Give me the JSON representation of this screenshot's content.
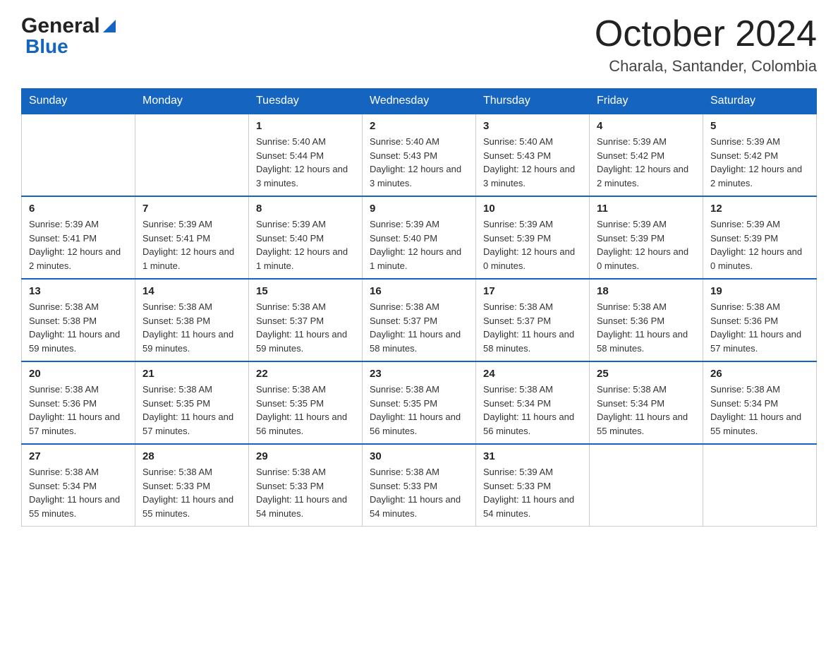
{
  "header": {
    "logo_general": "General",
    "logo_blue": "Blue",
    "month_title": "October 2024",
    "location": "Charala, Santander, Colombia"
  },
  "days_of_week": [
    "Sunday",
    "Monday",
    "Tuesday",
    "Wednesday",
    "Thursday",
    "Friday",
    "Saturday"
  ],
  "weeks": [
    [
      {
        "day": "",
        "sunrise": "",
        "sunset": "",
        "daylight": ""
      },
      {
        "day": "",
        "sunrise": "",
        "sunset": "",
        "daylight": ""
      },
      {
        "day": "1",
        "sunrise": "Sunrise: 5:40 AM",
        "sunset": "Sunset: 5:44 PM",
        "daylight": "Daylight: 12 hours and 3 minutes."
      },
      {
        "day": "2",
        "sunrise": "Sunrise: 5:40 AM",
        "sunset": "Sunset: 5:43 PM",
        "daylight": "Daylight: 12 hours and 3 minutes."
      },
      {
        "day": "3",
        "sunrise": "Sunrise: 5:40 AM",
        "sunset": "Sunset: 5:43 PM",
        "daylight": "Daylight: 12 hours and 3 minutes."
      },
      {
        "day": "4",
        "sunrise": "Sunrise: 5:39 AM",
        "sunset": "Sunset: 5:42 PM",
        "daylight": "Daylight: 12 hours and 2 minutes."
      },
      {
        "day": "5",
        "sunrise": "Sunrise: 5:39 AM",
        "sunset": "Sunset: 5:42 PM",
        "daylight": "Daylight: 12 hours and 2 minutes."
      }
    ],
    [
      {
        "day": "6",
        "sunrise": "Sunrise: 5:39 AM",
        "sunset": "Sunset: 5:41 PM",
        "daylight": "Daylight: 12 hours and 2 minutes."
      },
      {
        "day": "7",
        "sunrise": "Sunrise: 5:39 AM",
        "sunset": "Sunset: 5:41 PM",
        "daylight": "Daylight: 12 hours and 1 minute."
      },
      {
        "day": "8",
        "sunrise": "Sunrise: 5:39 AM",
        "sunset": "Sunset: 5:40 PM",
        "daylight": "Daylight: 12 hours and 1 minute."
      },
      {
        "day": "9",
        "sunrise": "Sunrise: 5:39 AM",
        "sunset": "Sunset: 5:40 PM",
        "daylight": "Daylight: 12 hours and 1 minute."
      },
      {
        "day": "10",
        "sunrise": "Sunrise: 5:39 AM",
        "sunset": "Sunset: 5:39 PM",
        "daylight": "Daylight: 12 hours and 0 minutes."
      },
      {
        "day": "11",
        "sunrise": "Sunrise: 5:39 AM",
        "sunset": "Sunset: 5:39 PM",
        "daylight": "Daylight: 12 hours and 0 minutes."
      },
      {
        "day": "12",
        "sunrise": "Sunrise: 5:39 AM",
        "sunset": "Sunset: 5:39 PM",
        "daylight": "Daylight: 12 hours and 0 minutes."
      }
    ],
    [
      {
        "day": "13",
        "sunrise": "Sunrise: 5:38 AM",
        "sunset": "Sunset: 5:38 PM",
        "daylight": "Daylight: 11 hours and 59 minutes."
      },
      {
        "day": "14",
        "sunrise": "Sunrise: 5:38 AM",
        "sunset": "Sunset: 5:38 PM",
        "daylight": "Daylight: 11 hours and 59 minutes."
      },
      {
        "day": "15",
        "sunrise": "Sunrise: 5:38 AM",
        "sunset": "Sunset: 5:37 PM",
        "daylight": "Daylight: 11 hours and 59 minutes."
      },
      {
        "day": "16",
        "sunrise": "Sunrise: 5:38 AM",
        "sunset": "Sunset: 5:37 PM",
        "daylight": "Daylight: 11 hours and 58 minutes."
      },
      {
        "day": "17",
        "sunrise": "Sunrise: 5:38 AM",
        "sunset": "Sunset: 5:37 PM",
        "daylight": "Daylight: 11 hours and 58 minutes."
      },
      {
        "day": "18",
        "sunrise": "Sunrise: 5:38 AM",
        "sunset": "Sunset: 5:36 PM",
        "daylight": "Daylight: 11 hours and 58 minutes."
      },
      {
        "day": "19",
        "sunrise": "Sunrise: 5:38 AM",
        "sunset": "Sunset: 5:36 PM",
        "daylight": "Daylight: 11 hours and 57 minutes."
      }
    ],
    [
      {
        "day": "20",
        "sunrise": "Sunrise: 5:38 AM",
        "sunset": "Sunset: 5:36 PM",
        "daylight": "Daylight: 11 hours and 57 minutes."
      },
      {
        "day": "21",
        "sunrise": "Sunrise: 5:38 AM",
        "sunset": "Sunset: 5:35 PM",
        "daylight": "Daylight: 11 hours and 57 minutes."
      },
      {
        "day": "22",
        "sunrise": "Sunrise: 5:38 AM",
        "sunset": "Sunset: 5:35 PM",
        "daylight": "Daylight: 11 hours and 56 minutes."
      },
      {
        "day": "23",
        "sunrise": "Sunrise: 5:38 AM",
        "sunset": "Sunset: 5:35 PM",
        "daylight": "Daylight: 11 hours and 56 minutes."
      },
      {
        "day": "24",
        "sunrise": "Sunrise: 5:38 AM",
        "sunset": "Sunset: 5:34 PM",
        "daylight": "Daylight: 11 hours and 56 minutes."
      },
      {
        "day": "25",
        "sunrise": "Sunrise: 5:38 AM",
        "sunset": "Sunset: 5:34 PM",
        "daylight": "Daylight: 11 hours and 55 minutes."
      },
      {
        "day": "26",
        "sunrise": "Sunrise: 5:38 AM",
        "sunset": "Sunset: 5:34 PM",
        "daylight": "Daylight: 11 hours and 55 minutes."
      }
    ],
    [
      {
        "day": "27",
        "sunrise": "Sunrise: 5:38 AM",
        "sunset": "Sunset: 5:34 PM",
        "daylight": "Daylight: 11 hours and 55 minutes."
      },
      {
        "day": "28",
        "sunrise": "Sunrise: 5:38 AM",
        "sunset": "Sunset: 5:33 PM",
        "daylight": "Daylight: 11 hours and 55 minutes."
      },
      {
        "day": "29",
        "sunrise": "Sunrise: 5:38 AM",
        "sunset": "Sunset: 5:33 PM",
        "daylight": "Daylight: 11 hours and 54 minutes."
      },
      {
        "day": "30",
        "sunrise": "Sunrise: 5:38 AM",
        "sunset": "Sunset: 5:33 PM",
        "daylight": "Daylight: 11 hours and 54 minutes."
      },
      {
        "day": "31",
        "sunrise": "Sunrise: 5:39 AM",
        "sunset": "Sunset: 5:33 PM",
        "daylight": "Daylight: 11 hours and 54 minutes."
      },
      {
        "day": "",
        "sunrise": "",
        "sunset": "",
        "daylight": ""
      },
      {
        "day": "",
        "sunrise": "",
        "sunset": "",
        "daylight": ""
      }
    ]
  ]
}
